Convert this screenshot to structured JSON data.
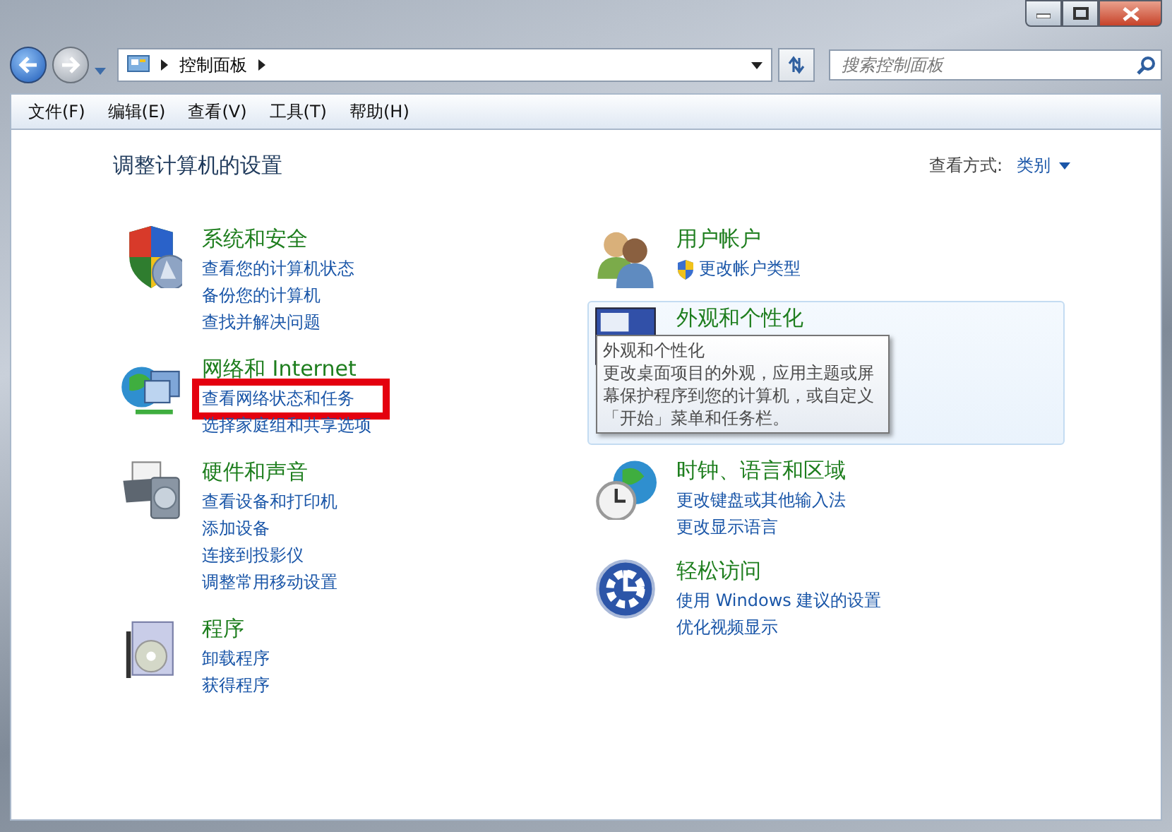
{
  "address_bar": {
    "path": [
      "控制面板"
    ]
  },
  "search": {
    "placeholder": "搜索控制面板"
  },
  "menu": [
    "文件(F)",
    "编辑(E)",
    "查看(V)",
    "工具(T)",
    "帮助(H)"
  ],
  "heading": "调整计算机的设置",
  "view_by": {
    "label": "查看方式:",
    "value": "类别"
  },
  "left_categories": [
    {
      "kind": "shield",
      "title": "系统和安全",
      "hovered": false,
      "links": [
        {
          "text": "查看您的计算机状态",
          "highlighted": false,
          "uac": false
        },
        {
          "text": "备份您的计算机",
          "highlighted": false,
          "uac": false
        },
        {
          "text": "查找并解决问题",
          "highlighted": false,
          "uac": false
        }
      ]
    },
    {
      "kind": "network",
      "title": "网络和 Internet",
      "hovered": false,
      "links": [
        {
          "text": "查看网络状态和任务",
          "highlighted": true,
          "uac": false
        },
        {
          "text": "选择家庭组和共享选项",
          "highlighted": false,
          "uac": false
        }
      ]
    },
    {
      "kind": "printer",
      "title": "硬件和声音",
      "hovered": false,
      "links": [
        {
          "text": "查看设备和打印机",
          "highlighted": false,
          "uac": false
        },
        {
          "text": "添加设备",
          "highlighted": false,
          "uac": false
        },
        {
          "text": "连接到投影仪",
          "highlighted": false,
          "uac": false
        },
        {
          "text": "调整常用移动设置",
          "highlighted": false,
          "uac": false
        }
      ]
    },
    {
      "kind": "programs",
      "title": "程序",
      "hovered": false,
      "links": [
        {
          "text": "卸载程序",
          "highlighted": false,
          "uac": false
        },
        {
          "text": "获得程序",
          "highlighted": false,
          "uac": false
        }
      ]
    }
  ],
  "right_categories": [
    {
      "kind": "users",
      "title": "用户帐户",
      "hovered": false,
      "links": [
        {
          "text": "更改帐户类型",
          "highlighted": false,
          "uac": true
        }
      ]
    },
    {
      "kind": "appearance",
      "title": "外观和个性化",
      "hovered": true,
      "tooltip": {
        "title": "外观和个性化",
        "text": "更改桌面项目的外观，应用主题或屏幕保护程序到您的计算机，或自定义「开始」菜单和任务栏。"
      }
    },
    {
      "kind": "clock",
      "title": "时钟、语言和区域",
      "hovered": false,
      "links": [
        {
          "text": "更改键盘或其他输入法",
          "highlighted": false,
          "uac": false
        },
        {
          "text": "更改显示语言",
          "highlighted": false,
          "uac": false
        }
      ]
    },
    {
      "kind": "access",
      "title": "轻松访问",
      "hovered": false,
      "links": [
        {
          "text": "使用 Windows 建议的设置",
          "highlighted": false,
          "uac": false
        },
        {
          "text": "优化视频显示",
          "highlighted": false,
          "uac": false
        }
      ]
    }
  ]
}
